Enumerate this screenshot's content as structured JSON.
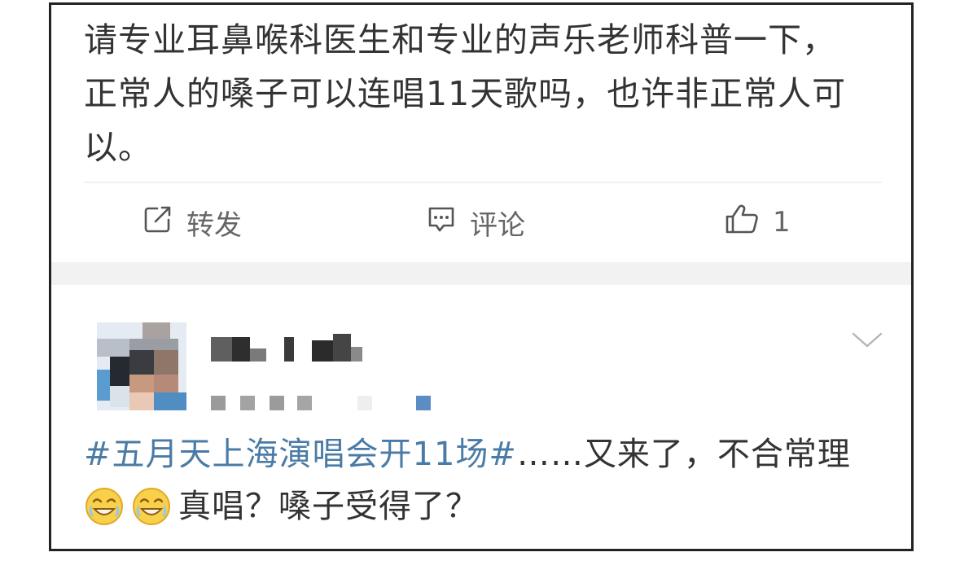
{
  "post": {
    "text_lines": [
      "请专业耳鼻喉科医生和专业的声乐老师科普一下，",
      "正常人的嗓子可以连唱11天歌吗，也许非正常人可",
      "以。"
    ]
  },
  "actions": {
    "repost_label": "转发",
    "comment_label": "评论",
    "like_count": "1",
    "icons": [
      "share-icon",
      "comment-icon",
      "thumbs-up-icon"
    ]
  },
  "comment": {
    "hashtag": "#五月天上海演唱会开11场#",
    "text_after_hashtag": "……又来了，不合常理",
    "second_line_text": "真唱？嗓子受得了？",
    "emojis": [
      "laughing-emoji",
      "laughing-emoji"
    ],
    "icons": [
      "chevron-down-icon"
    ]
  },
  "colors": {
    "text": "#333333",
    "secondary_text": "#666666",
    "hashtag": "#4a7ba6",
    "frame_border": "#222222",
    "separator": "#f2f2f2"
  }
}
